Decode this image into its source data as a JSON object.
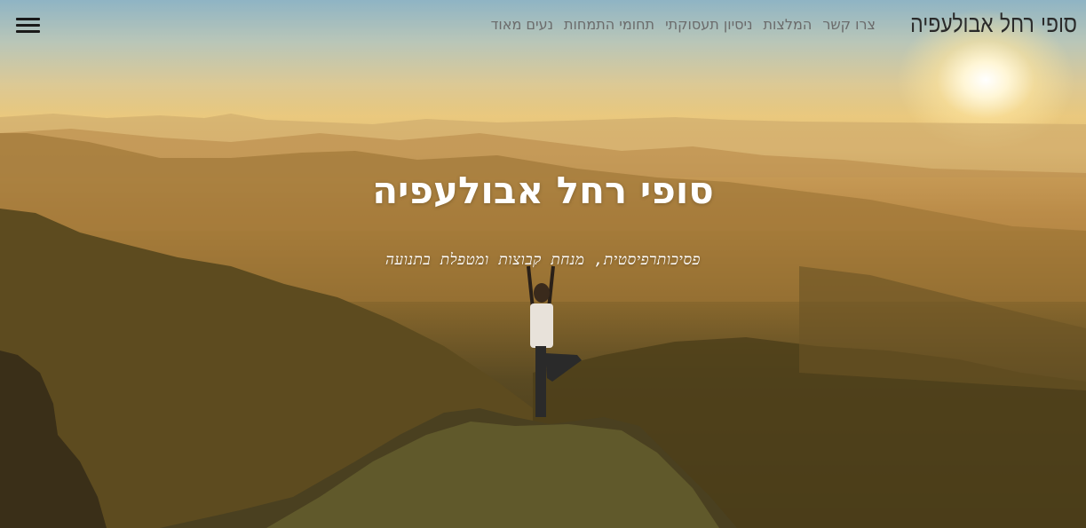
{
  "brand": {
    "name": "סופי רחל אבולעפיה"
  },
  "nav": {
    "items": [
      {
        "label": "צרו קשר"
      },
      {
        "label": "המלצות"
      },
      {
        "label": "ניסיון תעסוקתי"
      },
      {
        "label": "תחומי התמחות"
      },
      {
        "label": "נעים מאוד"
      }
    ],
    "menu_icon": "hamburger-menu-icon"
  },
  "hero": {
    "title": "סופי רחל אבולעפיה",
    "subtitle": "פסיכותרפיסטית, מנחת קבוצות ומטפלת בתנועה",
    "background": "sunset mountain landscape with woman in yoga tree pose"
  },
  "colors": {
    "nav_text": "#6b6b6b",
    "brand_text": "#2a2a2a",
    "hero_text": "#ffffff"
  }
}
